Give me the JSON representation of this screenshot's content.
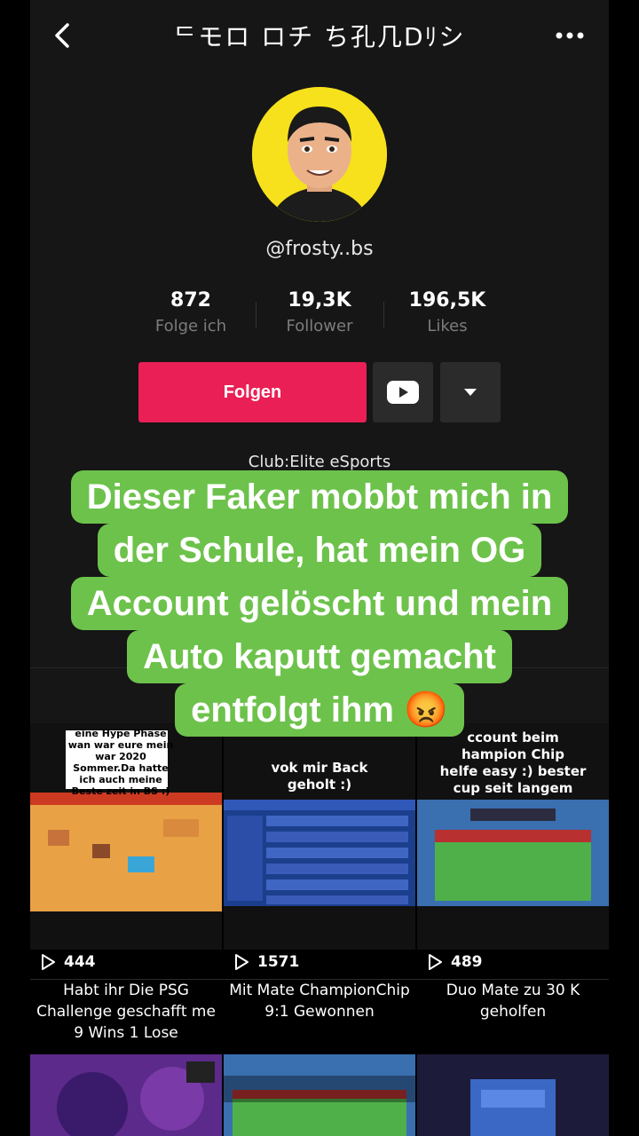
{
  "header": {
    "title": "ᄃモロ ロチ ち孔几Dﾘシ"
  },
  "profile": {
    "handle": "@frosty..bs",
    "stats": [
      {
        "value": "872",
        "label": "Folge ich"
      },
      {
        "value": "19,3K",
        "label": "Follower"
      },
      {
        "value": "196,5K",
        "label": "Likes"
      }
    ],
    "follow_label": "Folgen",
    "bio": "Club:Elite eSports"
  },
  "caption": {
    "lines": [
      "Dieser Faker mobbt mich in",
      "der Schule, hat mein OG",
      "Account gelöscht und mein",
      "Auto kaputt gemacht",
      "entfolgt ihm 😡"
    ]
  },
  "videos": [
    {
      "overlay": "eine Hype Phase\nwan war eure mein\nwar 2020\nSommer.Da hatte\nich auch meine\nBeste zeit in BS :)",
      "views": "444",
      "desc": "Habt ihr Die PSG Challenge geschafft me 9 Wins 1 Lose"
    },
    {
      "overlay": "vok mir Back\ngeholt :)",
      "views": "1571",
      "desc": "Mit Mate ChampionChip 9:1 Gewonnen"
    },
    {
      "overlay": "ccount beim\nhampion Chip\nhelfe easy :) bester\ncup seit langem",
      "views": "489",
      "desc": "Duo Mate zu 30 K geholfen"
    }
  ],
  "colors": {
    "follow": "#ea1f55",
    "caption_bg": "#6dc24b",
    "avatar_bg": "#f6e11c"
  }
}
